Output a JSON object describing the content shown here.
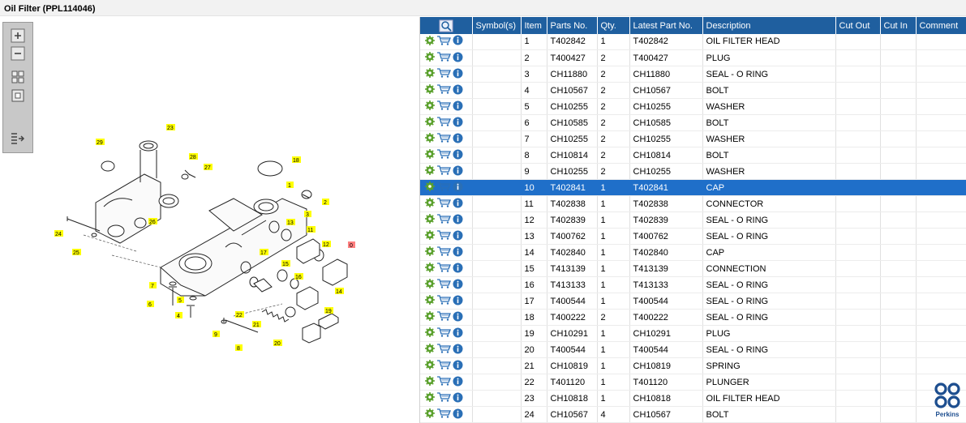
{
  "window": {
    "title": "Oil Filter (PPL114046)"
  },
  "toolbox": {
    "tools": [
      {
        "name": "zoom-in-icon"
      },
      {
        "name": "zoom-out-icon"
      },
      {
        "name": "fit-all-icon"
      },
      {
        "name": "fit-window-icon"
      },
      {
        "name": "export-list-icon"
      }
    ]
  },
  "diagram": {
    "callouts": [
      "1",
      "2",
      "3",
      "4",
      "5",
      "6",
      "7",
      "8",
      "9",
      "11",
      "12",
      "13",
      "14",
      "15",
      "16",
      "17",
      "18",
      "19",
      "20",
      "21",
      "22",
      "23",
      "24",
      "25",
      "26",
      "27",
      "28",
      "29"
    ],
    "highlighted_callout": "0",
    "callout_color": "#ffff00",
    "highlight_color": "#ff7f7f"
  },
  "grid": {
    "header_color": "#1f5f9f",
    "selected_color": "#1f6fc9",
    "columns": [
      "Symbol(s)",
      "Item",
      "Parts No.",
      "Qty.",
      "Latest Part No.",
      "Description",
      "Cut Out",
      "Cut In",
      "Comment"
    ],
    "row_icons": [
      "gear-icon",
      "cart-icon",
      "info-icon"
    ],
    "selected_index": 9,
    "rows": [
      {
        "item": "1",
        "part": "T402842",
        "qty": "1",
        "latest": "T402842",
        "desc": "OIL FILTER HEAD"
      },
      {
        "item": "2",
        "part": "T400427",
        "qty": "2",
        "latest": "T400427",
        "desc": "PLUG"
      },
      {
        "item": "3",
        "part": "CH11880",
        "qty": "2",
        "latest": "CH11880",
        "desc": "SEAL - O RING"
      },
      {
        "item": "4",
        "part": "CH10567",
        "qty": "2",
        "latest": "CH10567",
        "desc": "BOLT"
      },
      {
        "item": "5",
        "part": "CH10255",
        "qty": "2",
        "latest": "CH10255",
        "desc": "WASHER"
      },
      {
        "item": "6",
        "part": "CH10585",
        "qty": "2",
        "latest": "CH10585",
        "desc": "BOLT"
      },
      {
        "item": "7",
        "part": "CH10255",
        "qty": "2",
        "latest": "CH10255",
        "desc": "WASHER"
      },
      {
        "item": "8",
        "part": "CH10814",
        "qty": "2",
        "latest": "CH10814",
        "desc": "BOLT"
      },
      {
        "item": "9",
        "part": "CH10255",
        "qty": "2",
        "latest": "CH10255",
        "desc": "WASHER"
      },
      {
        "item": "10",
        "part": "T402841",
        "qty": "1",
        "latest": "T402841",
        "desc": "CAP"
      },
      {
        "item": "11",
        "part": "T402838",
        "qty": "1",
        "latest": "T402838",
        "desc": "CONNECTOR"
      },
      {
        "item": "12",
        "part": "T402839",
        "qty": "1",
        "latest": "T402839",
        "desc": "SEAL - O RING"
      },
      {
        "item": "13",
        "part": "T400762",
        "qty": "1",
        "latest": "T400762",
        "desc": "SEAL - O RING"
      },
      {
        "item": "14",
        "part": "T402840",
        "qty": "1",
        "latest": "T402840",
        "desc": "CAP"
      },
      {
        "item": "15",
        "part": "T413139",
        "qty": "1",
        "latest": "T413139",
        "desc": "CONNECTION"
      },
      {
        "item": "16",
        "part": "T413133",
        "qty": "1",
        "latest": "T413133",
        "desc": "SEAL - O RING"
      },
      {
        "item": "17",
        "part": "T400544",
        "qty": "1",
        "latest": "T400544",
        "desc": "SEAL - O RING"
      },
      {
        "item": "18",
        "part": "T400222",
        "qty": "2",
        "latest": "T400222",
        "desc": "SEAL - O RING"
      },
      {
        "item": "19",
        "part": "CH10291",
        "qty": "1",
        "latest": "CH10291",
        "desc": "PLUG"
      },
      {
        "item": "20",
        "part": "T400544",
        "qty": "1",
        "latest": "T400544",
        "desc": "SEAL - O RING"
      },
      {
        "item": "21",
        "part": "CH10819",
        "qty": "1",
        "latest": "CH10819",
        "desc": "SPRING"
      },
      {
        "item": "22",
        "part": "T401120",
        "qty": "1",
        "latest": "T401120",
        "desc": "PLUNGER"
      },
      {
        "item": "23",
        "part": "CH10818",
        "qty": "1",
        "latest": "CH10818",
        "desc": "OIL FILTER HEAD"
      },
      {
        "item": "24",
        "part": "CH10567",
        "qty": "4",
        "latest": "CH10567",
        "desc": "BOLT"
      }
    ]
  },
  "brand": {
    "name": "Perkins",
    "color": "#1d4e8f"
  }
}
